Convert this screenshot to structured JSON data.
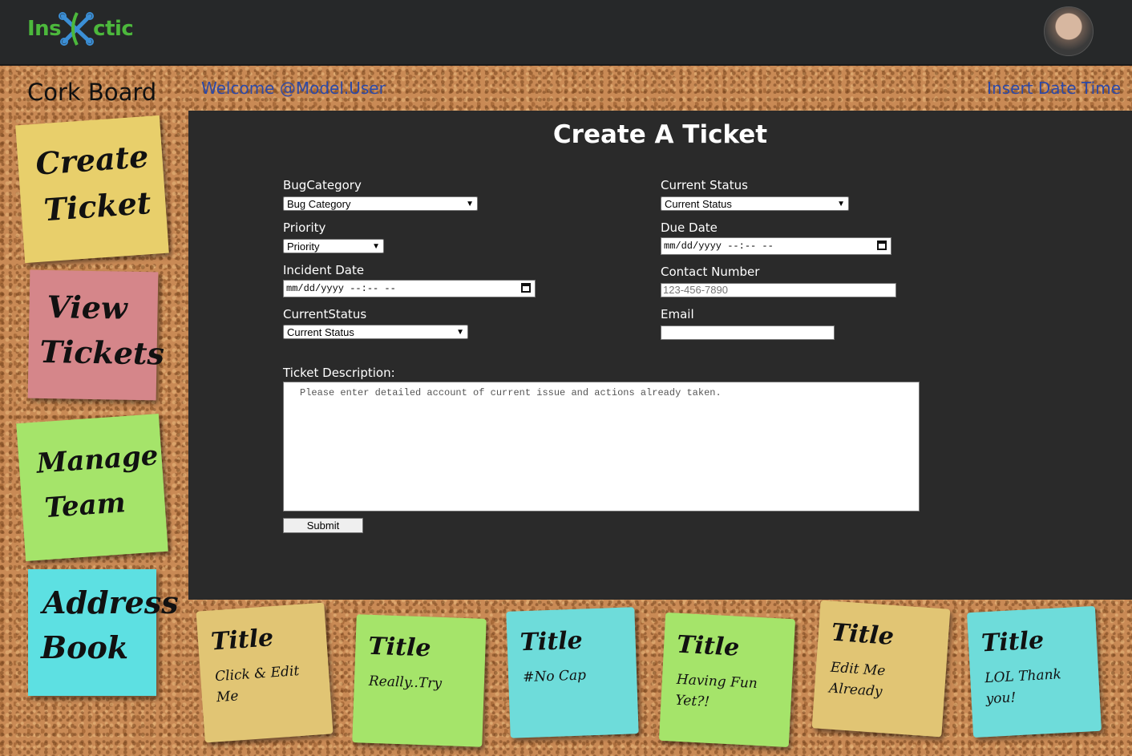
{
  "brand": {
    "logo_left": "Ins",
    "logo_right": "ctic",
    "accent": "#4cb83c"
  },
  "header": {
    "board_title": "Cork Board",
    "welcome": "Welcome @Model.User",
    "datetime": "Insert Date Time"
  },
  "sidebar": [
    {
      "line1": "Create",
      "line2": "Ticket"
    },
    {
      "line1": "View",
      "line2": "Tickets"
    },
    {
      "line1": "Manage",
      "line2": "Team"
    },
    {
      "line1": "Address",
      "line2": "Book"
    }
  ],
  "form": {
    "title": "Create A Ticket",
    "bug_category_label": "BugCategory",
    "bug_category_value": "Bug Category",
    "priority_label": "Priority",
    "priority_value": "Priority",
    "incident_date_label": "Incident Date",
    "incident_date_value": "mm/dd/yyyy --:-- --",
    "current_status2_label": "CurrentStatus",
    "current_status2_value": "Current Status",
    "current_status_label": "Current Status",
    "current_status_value": "Current Status",
    "due_date_label": "Due Date",
    "due_date_value": "mm/dd/yyyy --:-- --",
    "contact_label": "Contact Number",
    "contact_placeholder": "123-456-7890",
    "email_label": "Email",
    "email_value": "",
    "description_label": "Ticket Description:",
    "description_placeholder": "Please enter detailed account of current issue and actions already taken.",
    "submit_label": "Submit"
  },
  "notes": [
    {
      "title": "Title",
      "body": "Click & Edit Me",
      "color": "#e1c574"
    },
    {
      "title": "Title",
      "body": "Really..Try",
      "color": "#a5e46a"
    },
    {
      "title": "Title",
      "body": "#No Cap",
      "color": "#6edcda"
    },
    {
      "title": "Title",
      "body": "Having Fun Yet?!",
      "color": "#a5e46a"
    },
    {
      "title": "Title",
      "body": "Edit Me Already",
      "color": "#e1c574"
    },
    {
      "title": "Title",
      "body": "LOL Thank you!",
      "color": "#6edcda"
    }
  ]
}
